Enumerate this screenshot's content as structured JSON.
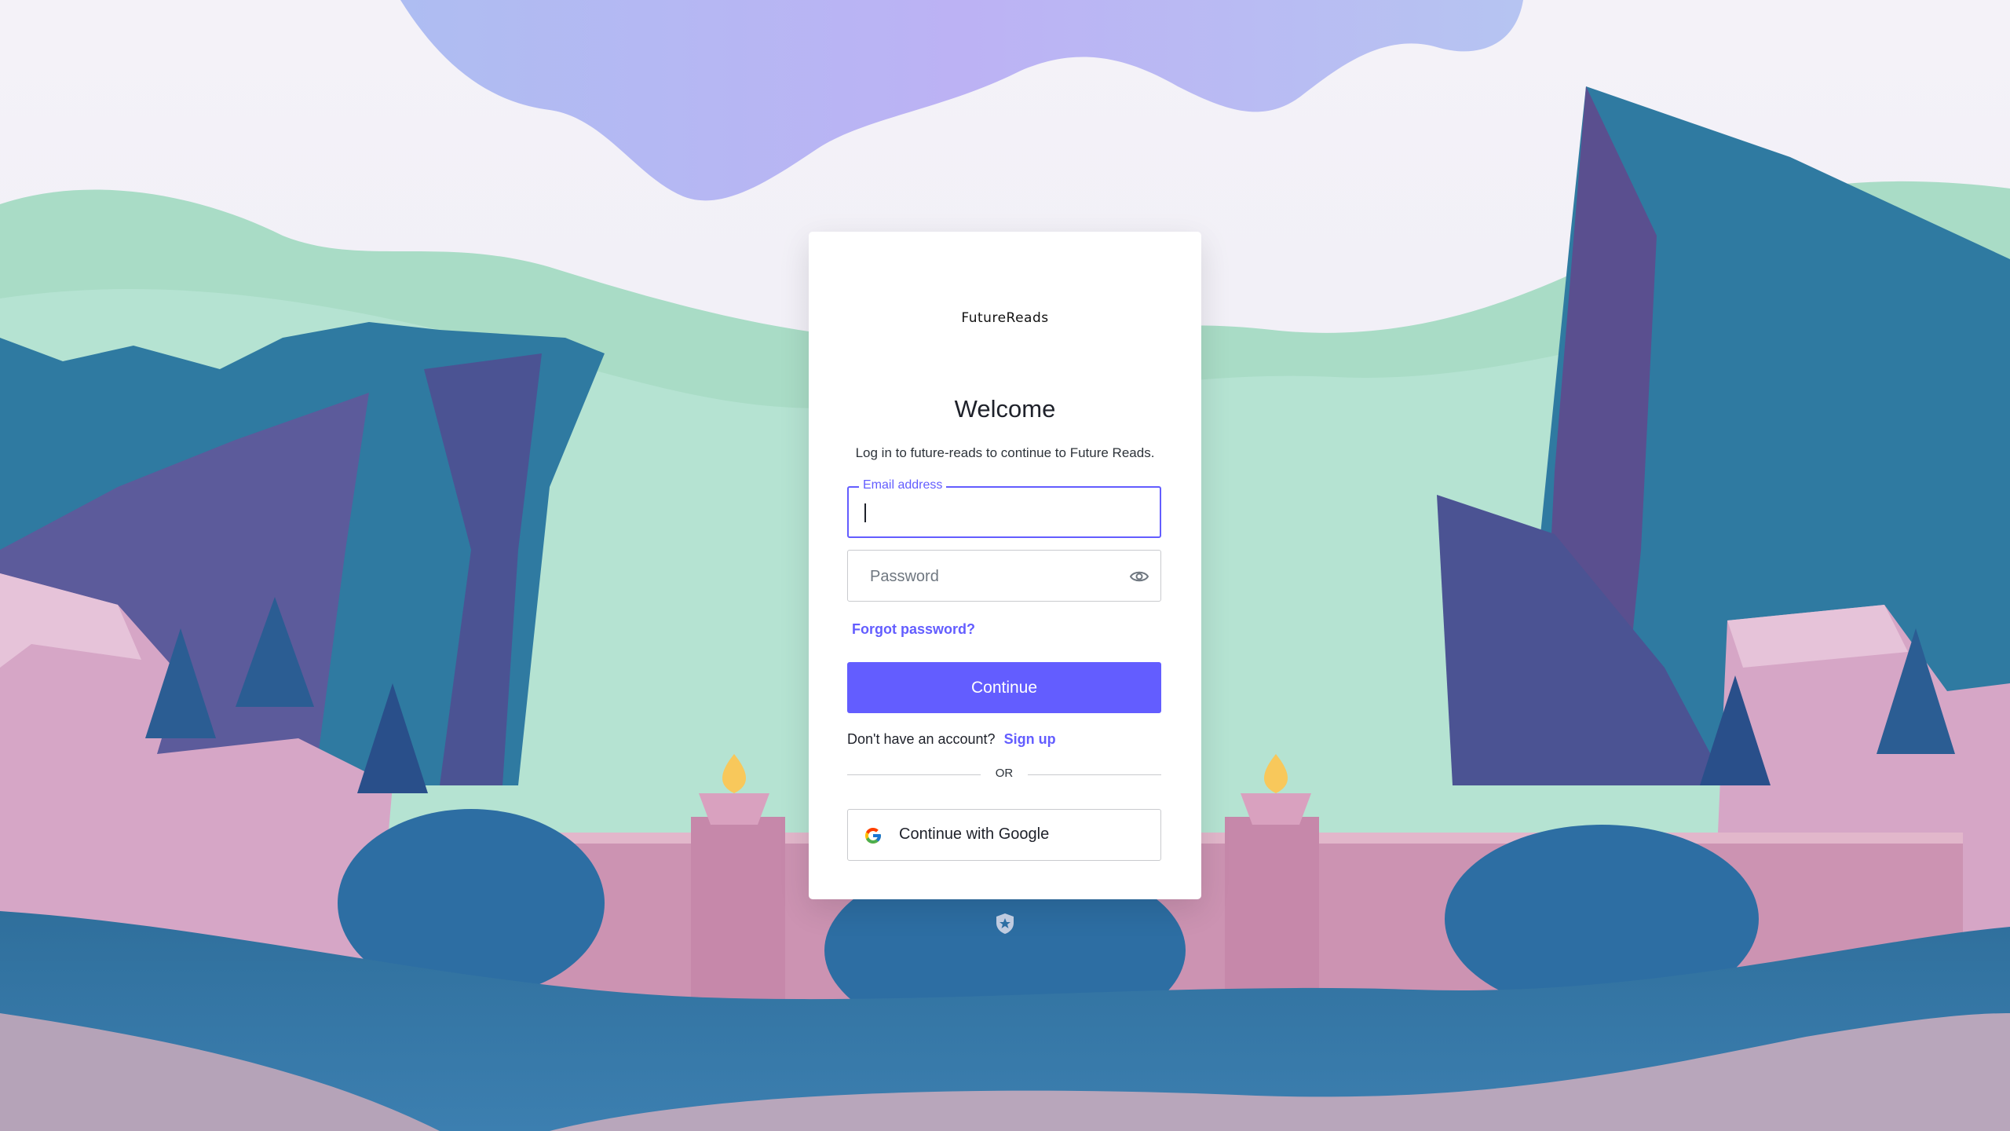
{
  "brand": {
    "logo_text": "FutureReads"
  },
  "login": {
    "title": "Welcome",
    "subtitle": "Log in to future-reads to continue to Future Reads.",
    "email_label": "Email address",
    "email_value": "",
    "password_placeholder": "Password",
    "forgot_label": "Forgot password?",
    "continue_label": "Continue",
    "signup_prompt": "Don't have an account?",
    "signup_label": "Sign up",
    "or_label": "OR",
    "google_label": "Continue with Google"
  },
  "icons": {
    "password_toggle": "eye-icon",
    "google": "google-logo-icon",
    "footer": "shield-icon"
  },
  "colors": {
    "accent": "#635dff",
    "text_dark": "#1e212a",
    "border": "#c9cace",
    "card_bg": "#ffffff"
  }
}
